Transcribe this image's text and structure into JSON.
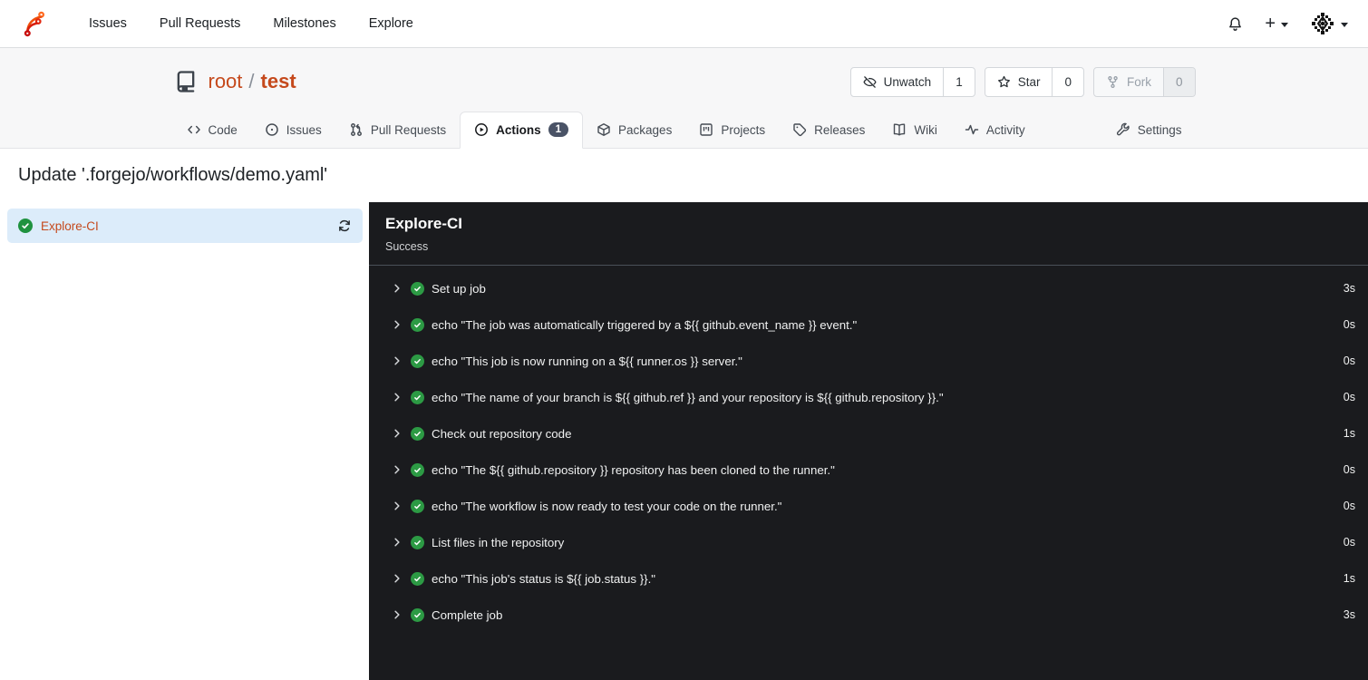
{
  "navbar": {
    "logo_icon": "forgejo-logo",
    "links": [
      {
        "label": "Issues"
      },
      {
        "label": "Pull Requests"
      },
      {
        "label": "Milestones"
      },
      {
        "label": "Explore"
      }
    ],
    "right": {
      "icons": [
        "bell-icon",
        "plus-icon",
        "avatar-identicon"
      ]
    }
  },
  "repo": {
    "icon": "repository-book-icon",
    "owner": "root",
    "separator": "/",
    "name": "test",
    "actions": {
      "unwatch": {
        "icon": "eye-slash-icon",
        "label": "Unwatch",
        "count": "1"
      },
      "star": {
        "icon": "star-icon",
        "label": "Star",
        "count": "0"
      },
      "fork": {
        "icon": "fork-icon",
        "label": "Fork",
        "count": "0",
        "disabled": true
      }
    },
    "tabs": [
      {
        "label": "Code",
        "icon": "code-icon"
      },
      {
        "label": "Issues",
        "icon": "issue-icon"
      },
      {
        "label": "Pull Requests",
        "icon": "pull-request-icon"
      },
      {
        "label": "Actions",
        "icon": "play-circle-icon",
        "badge": "1",
        "active": true
      },
      {
        "label": "Packages",
        "icon": "package-icon"
      },
      {
        "label": "Projects",
        "icon": "project-board-icon"
      },
      {
        "label": "Releases",
        "icon": "tag-icon"
      },
      {
        "label": "Wiki",
        "icon": "book-icon"
      },
      {
        "label": "Activity",
        "icon": "pulse-icon"
      },
      {
        "label": "Settings",
        "icon": "tools-icon",
        "right_aligned": true
      }
    ]
  },
  "run": {
    "title": "Update '.forgejo/workflows/demo.yaml'",
    "job": {
      "name": "Explore-CI",
      "status_icon": "check-circle-icon",
      "refresh_icon": "refresh-icon"
    },
    "panel": {
      "title": "Explore-CI",
      "status": "Success"
    },
    "steps": [
      {
        "label": "Set up job",
        "duration": "3s"
      },
      {
        "label": "echo \"The job was automatically triggered by a ${{ github.event_name }} event.\"",
        "duration": "0s"
      },
      {
        "label": "echo \"This job is now running on a ${{ runner.os }} server.\"",
        "duration": "0s"
      },
      {
        "label": "echo \"The name of your branch is ${{ github.ref }} and your repository is ${{ github.repository }}.\"",
        "duration": "0s"
      },
      {
        "label": "Check out repository code",
        "duration": "1s"
      },
      {
        "label": "echo \"The ${{ github.repository }} repository has been cloned to the runner.\"",
        "duration": "0s"
      },
      {
        "label": "echo \"The workflow is now ready to test your code on the runner.\"",
        "duration": "0s"
      },
      {
        "label": "List files in the repository",
        "duration": "0s"
      },
      {
        "label": "echo \"This job's status is ${{ job.status }}.\"",
        "duration": "1s"
      },
      {
        "label": "Complete job",
        "duration": "3s"
      }
    ]
  },
  "colors": {
    "accent_link": "#c5491c",
    "success_green_light": "#1f923f",
    "success_green_dark": "#2c9a44",
    "panel_bg": "#1a1b1e",
    "panel_divider": "#4a5058",
    "job_highlight_bg": "#dcecfa",
    "tab_badge_bg": "#4a5366",
    "header_bg": "#f7f7f8"
  }
}
